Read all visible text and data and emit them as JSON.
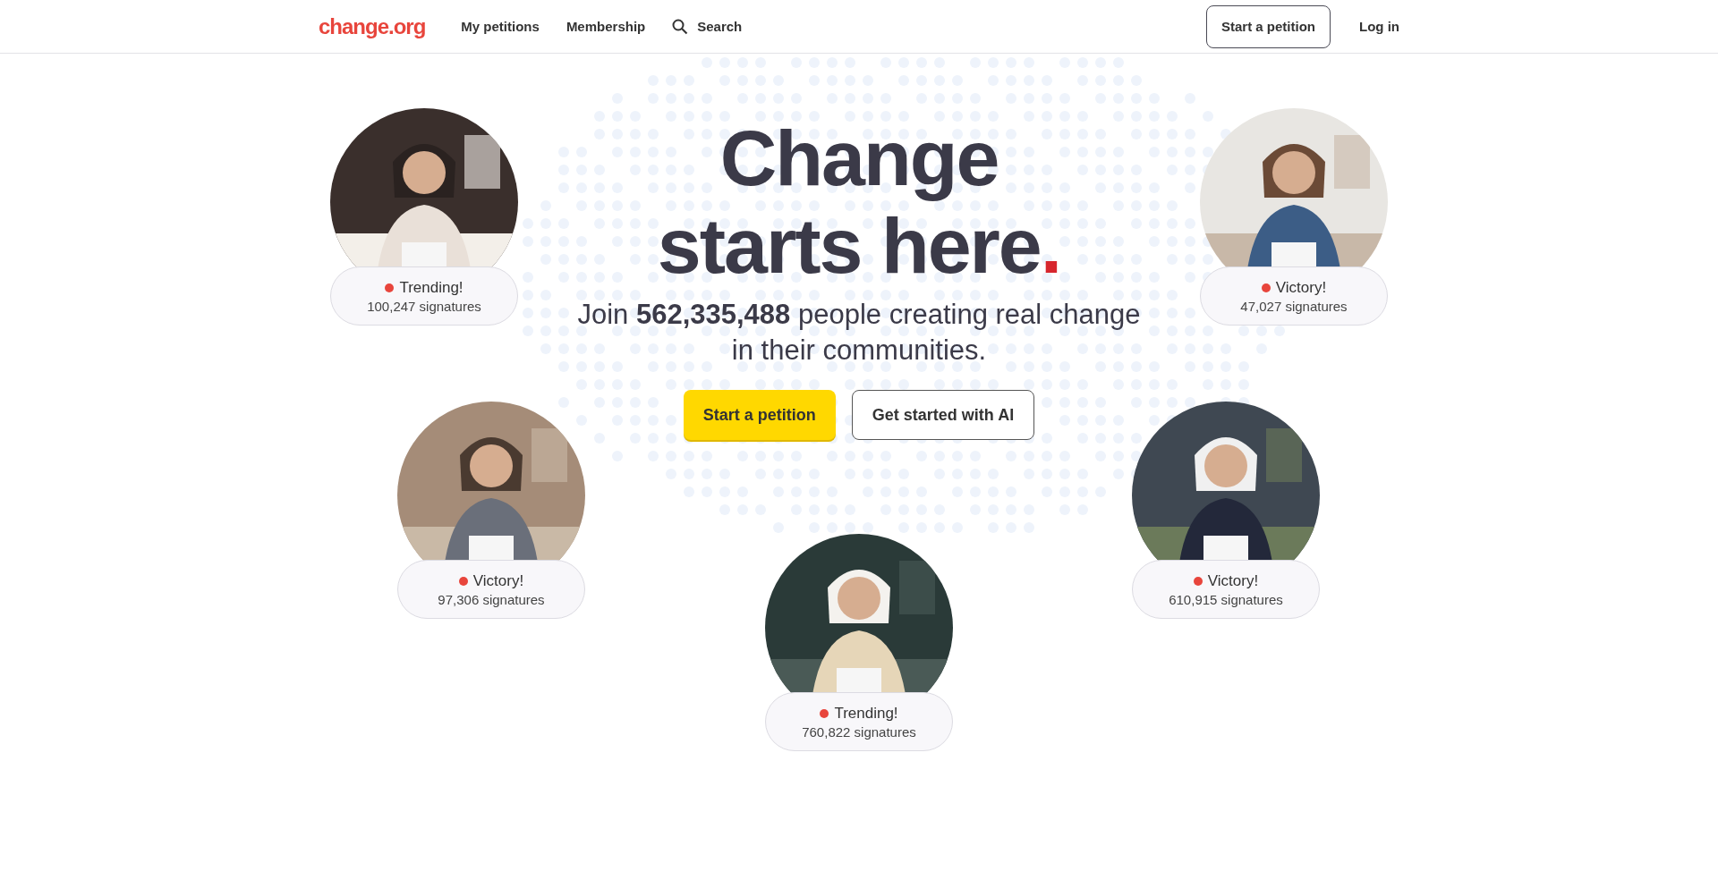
{
  "header": {
    "logo": "change.org",
    "nav": [
      "My petitions",
      "Membership"
    ],
    "search": "Search",
    "start_button": "Start a petition",
    "login": "Log in"
  },
  "hero": {
    "title_line1": "Change",
    "title_line2": "starts here",
    "title_accent": ".",
    "subtitle": "Join **562,335,488** people creating real change in their communities.",
    "primary_button": "Start a petition",
    "secondary_button": "Get started with AI"
  },
  "cards": [
    {
      "status": "Trending!",
      "signatures": "100,247 signatures"
    },
    {
      "status": "Victory!",
      "signatures": "47,027 signatures"
    },
    {
      "status": "Victory!",
      "signatures": "97,306 signatures"
    },
    {
      "status": "Victory!",
      "signatures": "610,915 signatures"
    },
    {
      "status": "Trending!",
      "signatures": "760,822 signatures"
    }
  ]
}
